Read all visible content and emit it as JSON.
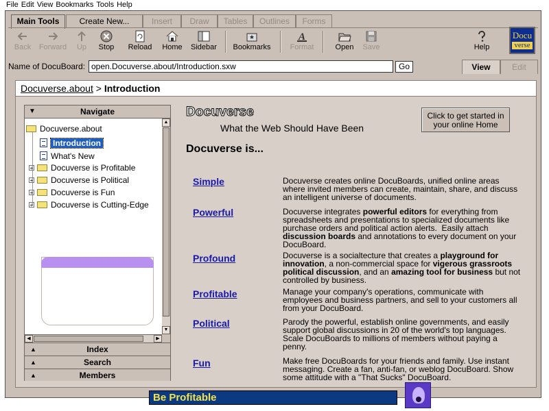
{
  "menu": [
    "File",
    "Edit",
    "View",
    "Bookmarks",
    "Tools",
    "Help"
  ],
  "tabs": [
    "Main Tools",
    "Create New...",
    "Insert",
    "Draw",
    "Tables",
    "Outlines",
    "Forms"
  ],
  "toolbar": {
    "back": "Back",
    "forward": "Forward",
    "up": "Up",
    "stop": "Stop",
    "reload": "Reload",
    "home": "Home",
    "sidebar": "Sidebar",
    "bookmarks": "Bookmarks",
    "format": "Format",
    "open": "Open",
    "save": "Save",
    "help": "Help"
  },
  "logo": {
    "top": "Docu",
    "bottom": "verse"
  },
  "address": {
    "label": "Name of DocuBoard:",
    "value": "open.Docuverse.about/Introduction.sxw",
    "go": "Go"
  },
  "mode_tabs": {
    "view": "View",
    "edit": "Edit"
  },
  "breadcrumb": {
    "parent": "Docuverse.about",
    "separator": ">",
    "current": "Introduction"
  },
  "navigate": {
    "title": "Navigate",
    "root": "Docuverse.about",
    "items": [
      "Introduction",
      "What's New"
    ],
    "folders": [
      "Docuverse is Profitable",
      "Docuverse is Political",
      "Docuverse is Fun",
      "Docuverse is Cutting-Edge"
    ]
  },
  "accordion": [
    "Index",
    "Search",
    "Members"
  ],
  "main": {
    "brand": "Docuverse",
    "tagline": "What the Web Should Have Been",
    "cta": "Click to get started in your online Home",
    "heading": "Docuverse is...",
    "features": [
      {
        "name": "Simple",
        "desc": "Docuverse creates online DocuBoards, unified online areas where invited members can create, maintain, share, and discuss an intelligent universe of documents."
      },
      {
        "name": "Powerful",
        "desc": "Docuverse integrates powerful editors for everything from spreadsheets and presentations to specialized documents like purchase orders and political action alerts.  Easily attach discussion boards and annotations to every document on your DocuBoard."
      },
      {
        "name": "Profound",
        "desc": "Docuverse is a socialtecture that creates a playground for innovation, a non-commercial space for vigerous grassroots political discussion, and an amazing tool for business but not controlled by business."
      },
      {
        "name": "Profitable",
        "desc": "Manage your company's operations, communicate with employees and business partners, and sell to your customers all from your DocuBoard."
      },
      {
        "name": "Political",
        "desc": "Parody the powerful, establish online governments, and easily support global discussions in 20 of the world's top languages. Scale DocuBoards to millions of members without paying a penny."
      },
      {
        "name": "Fun",
        "desc": "Make free DocuBoards for your friends and family.  Use instant messaging.  Create a fan, anti-fan, or weblog DocuBoard.  Show some attitude with a \"That Sucks\" DocuBoard."
      }
    ]
  },
  "banner": "Be Profitable",
  "colors": {
    "chrome": "#cbc0b8",
    "link": "#1a1aa8",
    "banner_bg": "#0c3a82",
    "banner_text": "#f5e34a",
    "selection": "#1f5fbf"
  }
}
